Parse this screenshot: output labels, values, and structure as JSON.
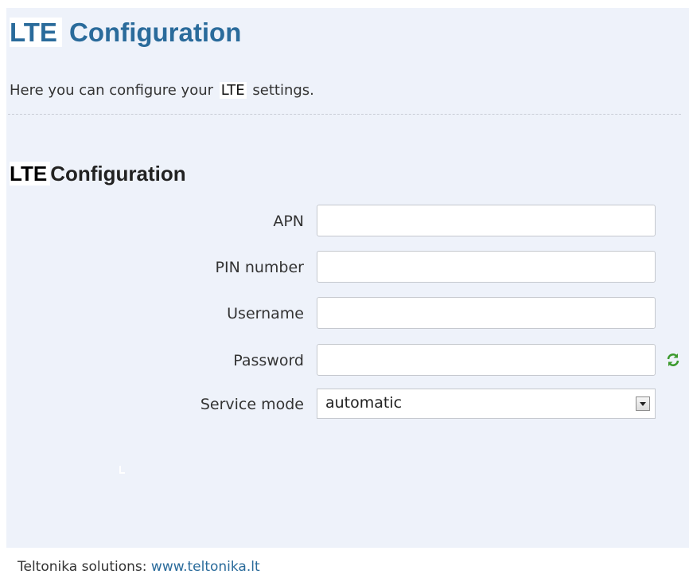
{
  "page": {
    "title_prefix": "LTE",
    "title_rest": " Configuration",
    "description_before": "Here you can configure your ",
    "description_highlight": "LTE",
    "description_after": " settings."
  },
  "section": {
    "title_prefix": "LTE",
    "title_rest": "Configuration"
  },
  "form": {
    "apn": {
      "label": "APN",
      "value": ""
    },
    "pin": {
      "label": "PIN number",
      "value": ""
    },
    "username": {
      "label": "Username",
      "value": ""
    },
    "password": {
      "label": "Password",
      "value": ""
    },
    "service_mode": {
      "label": "Service mode",
      "selected": "automatic"
    }
  },
  "icons": {
    "reveal_password": "refresh-icon",
    "dropdown": "chevron-down-icon"
  },
  "footer": {
    "prefix": "Teltonika solutions: ",
    "link_text": "www.teltonika.lt"
  },
  "colors": {
    "title": "#2a6b9b",
    "panel_background": "#eef2fa",
    "link": "#2a6b9b",
    "icon_green": "#3c9a2e"
  }
}
